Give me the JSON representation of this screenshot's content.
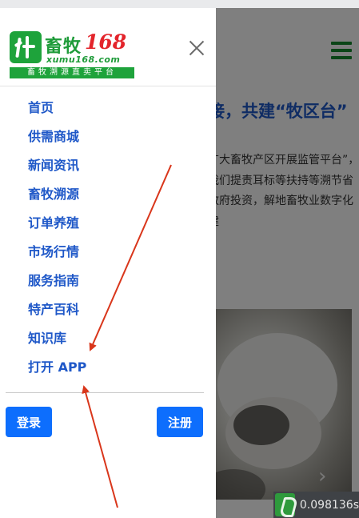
{
  "background": {
    "headline": "接，共建“牧区台”",
    "body": "广大畜牧产区开展监管平台”，我们提责耳标等扶持等溯节省政府投资，解地畜牧业数字化建"
  },
  "drawer": {
    "logo": {
      "name_cn": "畜牧",
      "name_num": "168",
      "url": "xumu168.com",
      "slogan": "畜牧溯源直卖平台"
    },
    "nav_items": [
      {
        "label": "首页"
      },
      {
        "label": "供需商城"
      },
      {
        "label": "新闻资讯"
      },
      {
        "label": "畜牧溯源"
      },
      {
        "label": "订单养殖"
      },
      {
        "label": "市场行情"
      },
      {
        "label": "服务指南"
      },
      {
        "label": "特产百科"
      },
      {
        "label": "知识库"
      },
      {
        "label": "打开 APP"
      }
    ],
    "login_label": "登录",
    "register_label": "注册"
  },
  "timer": {
    "value": "0.098136s"
  },
  "colors": {
    "brand_green": "#1ea33b",
    "brand_red": "#e3242b",
    "link_blue": "#1f58c8",
    "button_blue": "#0d6efd",
    "annotation_red": "#d9361b"
  },
  "icons": {
    "close": "close-icon",
    "hamburger": "hamburger-menu-icon",
    "next": "chevron-right-icon"
  }
}
